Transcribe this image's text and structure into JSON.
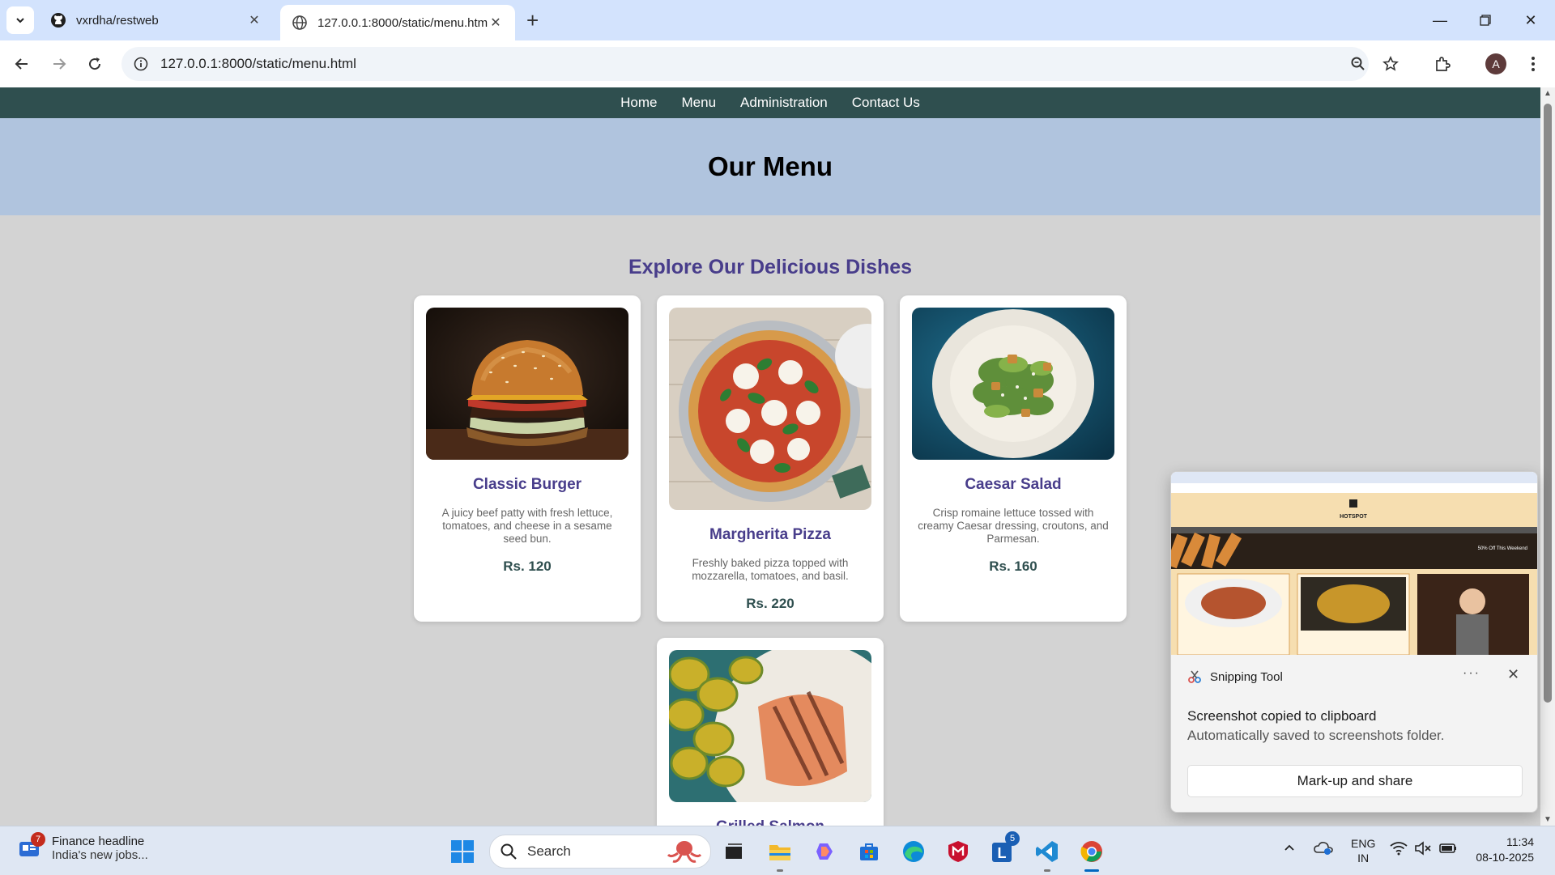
{
  "browser": {
    "tabs": [
      {
        "title": "vxrdha/restweb",
        "icon": "github-icon"
      },
      {
        "title": "127.0.0.1:8000/static/menu.html",
        "icon": "globe-icon"
      }
    ],
    "address": "127.0.0.1:8000/static/menu.html",
    "profile_initial": "A"
  },
  "site": {
    "nav": [
      "Home",
      "Menu",
      "Administration",
      "Contact Us"
    ],
    "hero_title": "Our Menu",
    "section_title": "Explore Our Delicious Dishes",
    "dishes": [
      {
        "name": "Classic Burger",
        "description": "A juicy beef patty with fresh lettuce, tomatoes, and cheese in a sesame seed bun.",
        "price": "Rs. 120",
        "image": "burger"
      },
      {
        "name": "Margherita Pizza",
        "description": "Freshly baked pizza topped with mozzarella, tomatoes, and basil.",
        "price": "Rs. 220",
        "image": "pizza"
      },
      {
        "name": "Caesar Salad",
        "description": "Crisp romaine lettuce tossed with creamy Caesar dressing, croutons, and Parmesan.",
        "price": "Rs. 160",
        "image": "salad"
      },
      {
        "name": "Grilled Salmon",
        "image": "salmon"
      }
    ]
  },
  "toast": {
    "app_name": "Snipping Tool",
    "title": "Screenshot copied to clipboard",
    "subtitle": "Automatically saved to screenshots folder.",
    "action": "Mark-up and share",
    "preview_brand": "HOTSPOT",
    "preview_banner": "50% Off This Weekend"
  },
  "taskbar": {
    "news_badge": "7",
    "news_headline": "Finance headline",
    "news_sub": "India's new jobs...",
    "search_placeholder": "Search",
    "outlook_badge": "5",
    "lang_top": "ENG",
    "lang_bottom": "IN",
    "time": "11:34",
    "date": "08-10-2025"
  },
  "colors": {
    "nav_bg": "#2f4f4f",
    "hero_bg": "#b0c4de",
    "accent": "#483d8b",
    "price": "#2f4f4f",
    "page_bg": "#d3d3d3"
  }
}
